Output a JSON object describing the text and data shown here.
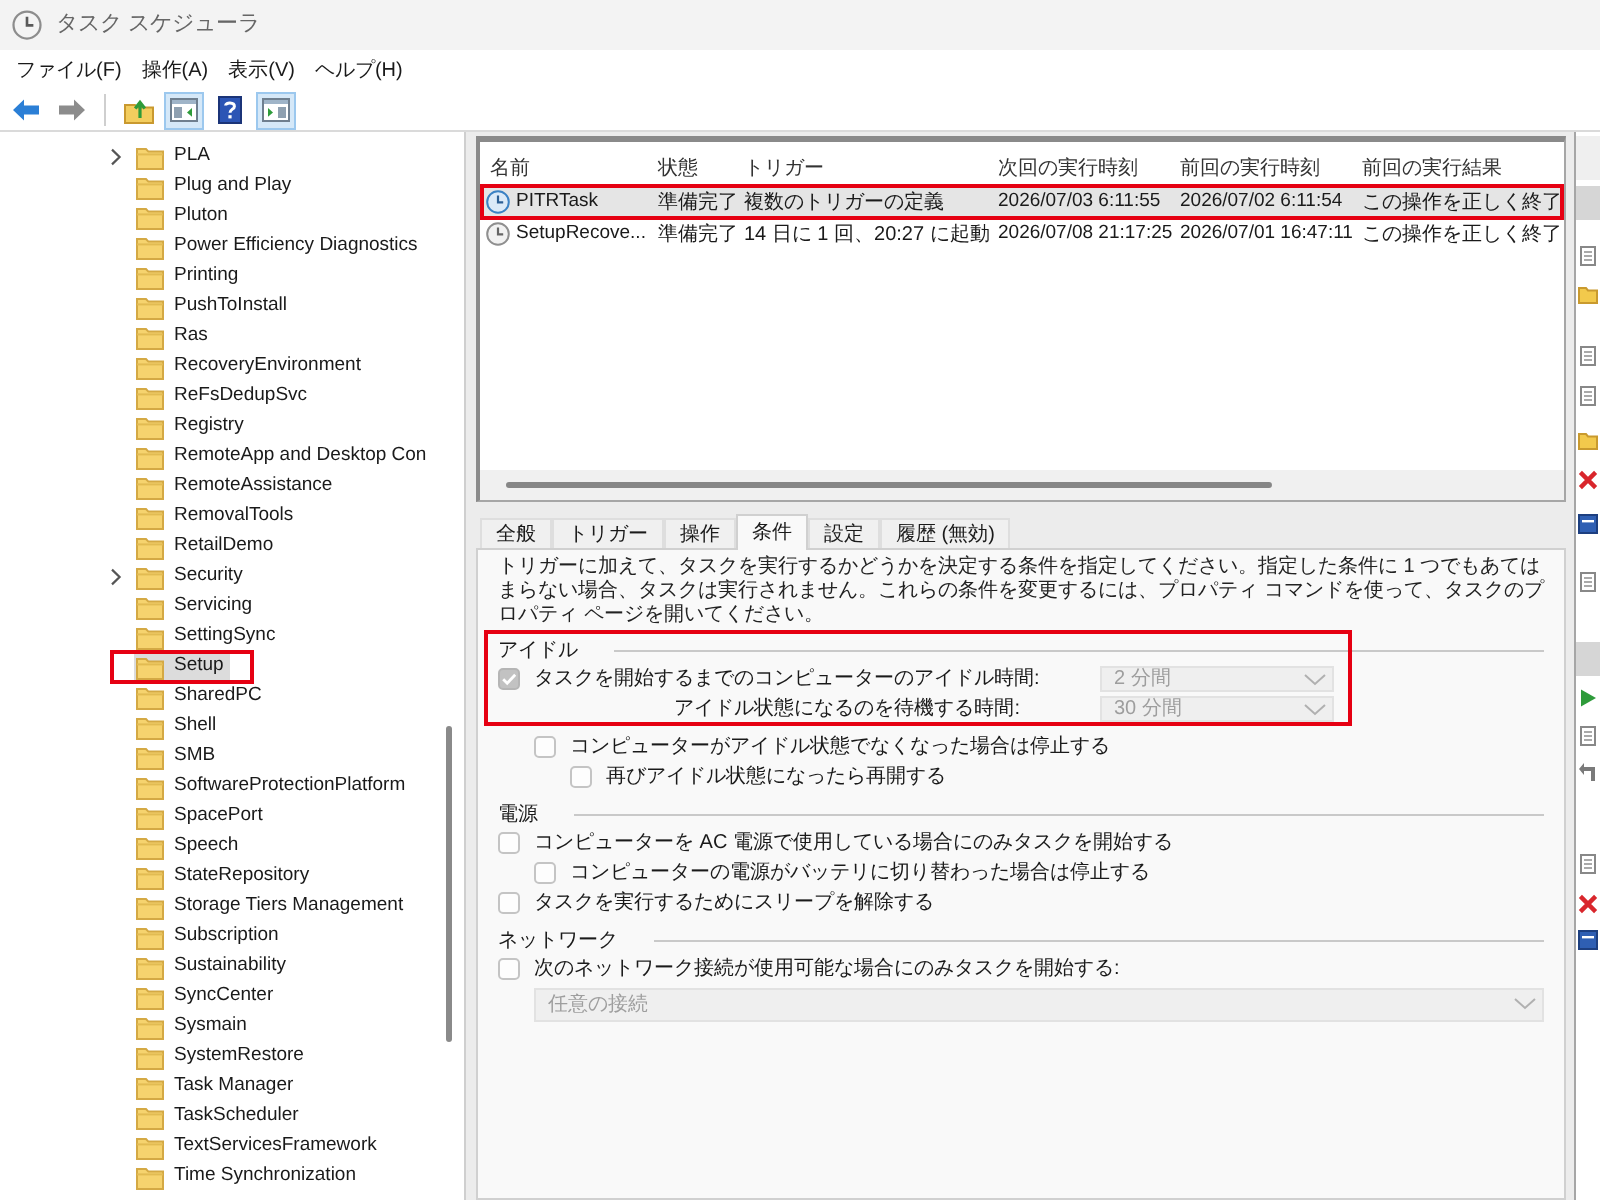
{
  "window": {
    "title": "タスク スケジューラ"
  },
  "menu": [
    "ファイル(F)",
    "操作(A)",
    "表示(V)",
    "ヘルプ(H)"
  ],
  "toolbar": [
    [
      {
        "kind": "back",
        "on": false,
        "disabled": false
      },
      {
        "kind": "forward",
        "on": false,
        "disabled": true
      }
    ],
    [
      {
        "kind": "up",
        "on": false,
        "disabled": false
      },
      {
        "kind": "tree_pane",
        "on": true,
        "disabled": false
      },
      {
        "kind": "help",
        "on": false,
        "disabled": false
      },
      {
        "kind": "action_pane",
        "on": true,
        "disabled": false
      }
    ]
  ],
  "tree": {
    "items": [
      {
        "label": "PLA",
        "expandable": true,
        "selected": false,
        "marked": false
      },
      {
        "label": "Plug and Play",
        "expandable": false,
        "selected": false,
        "marked": false
      },
      {
        "label": "Pluton",
        "expandable": false,
        "selected": false,
        "marked": false
      },
      {
        "label": "Power Efficiency Diagnostics",
        "expandable": false,
        "selected": false,
        "marked": false
      },
      {
        "label": "Printing",
        "expandable": false,
        "selected": false,
        "marked": false
      },
      {
        "label": "PushToInstall",
        "expandable": false,
        "selected": false,
        "marked": false
      },
      {
        "label": "Ras",
        "expandable": false,
        "selected": false,
        "marked": false
      },
      {
        "label": "RecoveryEnvironment",
        "expandable": false,
        "selected": false,
        "marked": false
      },
      {
        "label": "ReFsDedupSvc",
        "expandable": false,
        "selected": false,
        "marked": false
      },
      {
        "label": "Registry",
        "expandable": false,
        "selected": false,
        "marked": false
      },
      {
        "label": "RemoteApp and Desktop Con",
        "expandable": false,
        "selected": false,
        "marked": false
      },
      {
        "label": "RemoteAssistance",
        "expandable": false,
        "selected": false,
        "marked": false
      },
      {
        "label": "RemovalTools",
        "expandable": false,
        "selected": false,
        "marked": false
      },
      {
        "label": "RetailDemo",
        "expandable": false,
        "selected": false,
        "marked": false
      },
      {
        "label": "Security",
        "expandable": true,
        "selected": false,
        "marked": false
      },
      {
        "label": "Servicing",
        "expandable": false,
        "selected": false,
        "marked": false
      },
      {
        "label": "SettingSync",
        "expandable": false,
        "selected": false,
        "marked": false
      },
      {
        "label": "Setup",
        "expandable": false,
        "selected": true,
        "marked": true
      },
      {
        "label": "SharedPC",
        "expandable": false,
        "selected": false,
        "marked": false
      },
      {
        "label": "Shell",
        "expandable": false,
        "selected": false,
        "marked": false
      },
      {
        "label": "SMB",
        "expandable": false,
        "selected": false,
        "marked": false
      },
      {
        "label": "SoftwareProtectionPlatform",
        "expandable": false,
        "selected": false,
        "marked": false
      },
      {
        "label": "SpacePort",
        "expandable": false,
        "selected": false,
        "marked": false
      },
      {
        "label": "Speech",
        "expandable": false,
        "selected": false,
        "marked": false
      },
      {
        "label": "StateRepository",
        "expandable": false,
        "selected": false,
        "marked": false
      },
      {
        "label": "Storage Tiers Management",
        "expandable": false,
        "selected": false,
        "marked": false
      },
      {
        "label": "Subscription",
        "expandable": false,
        "selected": false,
        "marked": false
      },
      {
        "label": "Sustainability",
        "expandable": false,
        "selected": false,
        "marked": false
      },
      {
        "label": "SyncCenter",
        "expandable": false,
        "selected": false,
        "marked": false
      },
      {
        "label": "Sysmain",
        "expandable": false,
        "selected": false,
        "marked": false
      },
      {
        "label": "SystemRestore",
        "expandable": false,
        "selected": false,
        "marked": false
      },
      {
        "label": "Task Manager",
        "expandable": false,
        "selected": false,
        "marked": false
      },
      {
        "label": "TaskScheduler",
        "expandable": false,
        "selected": false,
        "marked": false
      },
      {
        "label": "TextServicesFramework",
        "expandable": false,
        "selected": false,
        "marked": false
      },
      {
        "label": "Time Synchronization",
        "expandable": false,
        "selected": false,
        "marked": false
      }
    ]
  },
  "task_list": {
    "columns": [
      "名前",
      "状態",
      "トリガー",
      "次回の実行時刻",
      "前回の実行時刻",
      "前回の実行結果"
    ],
    "rows": [
      {
        "cells": [
          "PITRTask",
          "準備完了",
          "複数のトリガーの定義",
          "2026/07/03 6:11:55",
          "2026/07/02 6:11:54",
          "この操作を正しく終了"
        ],
        "selected": true,
        "marked": true
      },
      {
        "cells": [
          "SetupRecove...",
          "準備完了",
          "14 日に 1 回、20:27 に起動",
          "2026/07/08 21:17:25",
          "2026/07/01 16:47:11",
          "この操作を正しく終了"
        ],
        "selected": false,
        "marked": false
      }
    ]
  },
  "details": {
    "tabs": [
      {
        "label": "全般",
        "selected": false
      },
      {
        "label": "トリガー",
        "selected": false
      },
      {
        "label": "操作",
        "selected": false
      },
      {
        "label": "条件",
        "selected": true
      },
      {
        "label": "設定",
        "selected": false
      },
      {
        "label": "履歴 (無効)",
        "selected": false
      }
    ],
    "description": "トリガーに加えて、タスクを実行するかどうかを決定する条件を指定してください。指定した条件に 1 つでもあてはまらない場合、タスクは実行されません。これらの条件を変更するには、プロパティ コマンドを使って、タスクのプロパティ ページを開いてください。",
    "sections": [
      {
        "title": "アイドル",
        "marked": true,
        "rows": [
          {
            "kind": "checkbox",
            "label": "タスクを開始するまでのコンピューターのアイドル時間:",
            "checked": true,
            "marked": true,
            "select": {
              "value": "2 分間",
              "disabled": true
            },
            "children": [
              {
                "kind": "field",
                "label": "アイドル状態になるのを待機する時間:",
                "marked": true,
                "select": {
                  "value": "30 分間",
                  "disabled": true
                }
              },
              {
                "kind": "checkbox",
                "label": "コンピューターがアイドル状態でなくなった場合は停止する",
                "checked": false,
                "marked": false,
                "children": [
                  {
                    "kind": "checkbox",
                    "label": "再びアイドル状態になったら再開する",
                    "checked": false,
                    "marked": false
                  }
                ]
              }
            ]
          }
        ]
      },
      {
        "title": "電源",
        "marked": false,
        "rows": [
          {
            "kind": "checkbox",
            "label": "コンピューターを AC 電源で使用している場合にのみタスクを開始する",
            "checked": false,
            "marked": false,
            "children": [
              {
                "kind": "checkbox",
                "label": "コンピューターの電源がバッテリに切り替わった場合は停止する",
                "checked": false,
                "marked": false
              }
            ]
          },
          {
            "kind": "checkbox",
            "label": "タスクを実行するためにスリープを解除する",
            "checked": false,
            "marked": false
          }
        ]
      },
      {
        "title": "ネットワーク",
        "marked": false,
        "rows": [
          {
            "kind": "checkbox",
            "label": "次のネットワーク接続が使用可能な場合にのみタスクを開始する:",
            "checked": false,
            "marked": false,
            "children": [
              {
                "kind": "select",
                "value": "任意の接続",
                "disabled": true,
                "marked": false
              }
            ]
          }
        ]
      }
    ]
  }
}
